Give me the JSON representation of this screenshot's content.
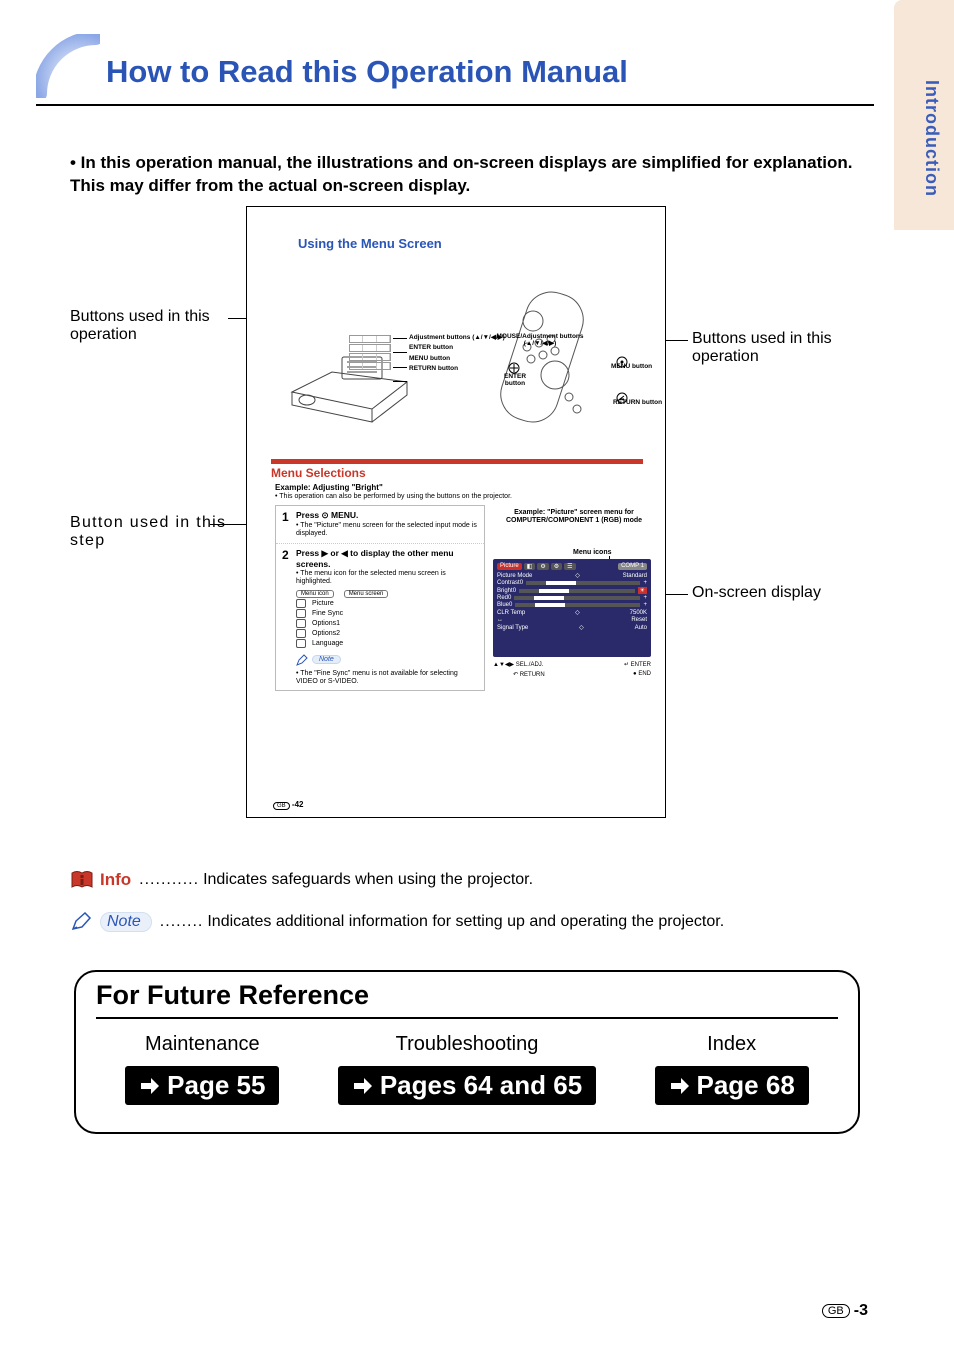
{
  "sideTab": {
    "label": "Introduction"
  },
  "heading": "How to Read this Operation Manual",
  "intro": "• In this operation manual, the illustrations and on-screen displays are simplified for explanation. This may differ from the actual on-screen display.",
  "sample": {
    "title": "Using the Menu Screen",
    "adjLabels": {
      "adjustment": "Adjustment buttons (▲/▼/◀/▶)",
      "enter": "ENTER button",
      "menu": "MENU button",
      "return": "RETURN button"
    },
    "remoteLabels": {
      "mouseAdj": "MOUSE/Adjustment buttons (▲/▼/◀/▶)",
      "enter": "ENTER button",
      "menu": "MENU button",
      "return": "RETURN button"
    },
    "menuBand": "Menu Selections",
    "exampleLine": "Example: Adjusting \"Bright\"",
    "exampleSub": "• This operation can also be performed by using the buttons on the projector.",
    "step1": {
      "num": "1",
      "lead": "Press ⊙ MENU.",
      "sub": "• The \"Picture\" menu screen for the selected input mode is displayed."
    },
    "step2": {
      "num": "2",
      "lead": "Press ▶ or ◀ to display the other menu screens.",
      "sub": "• The menu icon for the selected menu screen is highlighted.",
      "tableHdrIcon": "Menu icon",
      "tableHdrScreen": "Menu screen",
      "rows": [
        "Picture",
        "Fine Sync",
        "Options1",
        "Options2",
        "Language"
      ]
    },
    "noteTag": "Note",
    "noteBody": "• The \"Fine Sync\" menu is not available for selecting VIDEO or S-VIDEO.",
    "rightExample": "Example: \"Picture\" screen menu for COMPUTER/COMPONENT 1 (RGB) mode",
    "menuIconsLbl": "Menu icons",
    "osd": {
      "tab": "Picture",
      "comp": "COMP 1",
      "rows": [
        {
          "k": "Picture Mode",
          "v": "Standard"
        },
        {
          "k": "Contrast",
          "v": "0"
        },
        {
          "k": "Bright",
          "v": "0"
        },
        {
          "k": "Red",
          "v": "0"
        },
        {
          "k": "Blue",
          "v": "0"
        },
        {
          "k": "CLR Temp",
          "v": "7500K"
        },
        {
          "k": "Reset",
          "v": ""
        },
        {
          "k": "Signal Type",
          "v": "Auto"
        }
      ],
      "foot": {
        "left": "▲▼◀▶ SEL./ADJ.",
        "mid": "↵ ENTER",
        "ret": "RETURN",
        "end": "● END"
      }
    },
    "pageNum": "GB -42"
  },
  "callouts": {
    "leftTop": "Buttons used in this operation",
    "leftBottom": "Button used in this step",
    "rightTop": "Buttons used in this operation",
    "rightBottom": "On-screen display"
  },
  "legend": {
    "infoTag": "Info",
    "infoText": "Indicates safeguards when using the projector.",
    "noteTag": "Note",
    "noteText": "Indicates additional information for setting up and operating the projector."
  },
  "future": {
    "title": "For Future Reference",
    "cols": [
      {
        "sub": "Maintenance",
        "btn": "Page 55"
      },
      {
        "sub": "Troubleshooting",
        "btn": "Pages 64 and 65"
      },
      {
        "sub": "Index",
        "btn": "Page 68"
      }
    ]
  },
  "footer": {
    "gb": "GB",
    "num": "-3"
  }
}
